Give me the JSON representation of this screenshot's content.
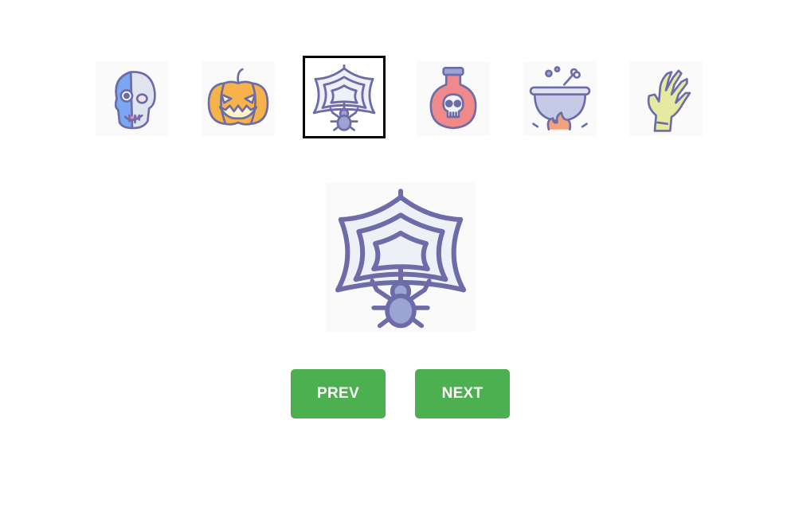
{
  "gallery": {
    "thumbnails": [
      {
        "icon": "zombie-skull-icon",
        "selected": false
      },
      {
        "icon": "jack-o-lantern-icon",
        "selected": false
      },
      {
        "icon": "spider-web-icon",
        "selected": true
      },
      {
        "icon": "poison-potion-icon",
        "selected": false
      },
      {
        "icon": "witch-cauldron-icon",
        "selected": false
      },
      {
        "icon": "zombie-hand-icon",
        "selected": false
      }
    ],
    "main_icon": "spider-web-icon"
  },
  "controls": {
    "prev_label": "PREV",
    "next_label": "NEXT"
  },
  "colors": {
    "button_bg": "#4caf50",
    "button_text": "#ffffff",
    "selected_border": "#000000",
    "icon_outline": "#6b6ca8"
  }
}
